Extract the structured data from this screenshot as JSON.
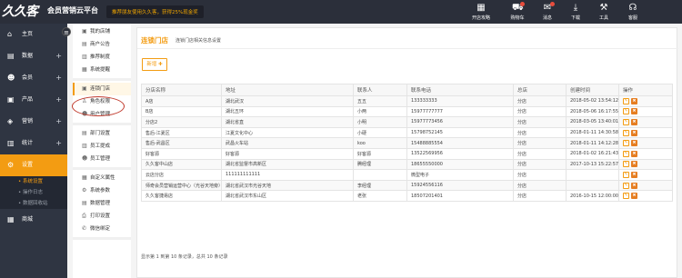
{
  "app": {
    "logo_text": "久久客",
    "title": "会员营销云平台",
    "promo": "推荐朋友使用久久客，获得25%现金奖"
  },
  "toolbar": [
    {
      "icon": "store-icon",
      "label": "开店攻略",
      "glyph": "▦",
      "badge": false
    },
    {
      "icon": "cart-icon",
      "label": "购物车",
      "glyph": "⛟",
      "badge": true
    },
    {
      "icon": "mail-icon",
      "label": "消息",
      "glyph": "✉",
      "badge": true
    },
    {
      "icon": "download-icon",
      "label": "下载",
      "glyph": "⤓",
      "badge": false
    },
    {
      "icon": "tools-icon",
      "label": "工具",
      "glyph": "⚒",
      "badge": false
    },
    {
      "icon": "service-icon",
      "label": "客服",
      "glyph": "☊",
      "badge": false
    }
  ],
  "sidebar": {
    "items": [
      {
        "label": "主页",
        "glyph": "⌂",
        "plus": false
      },
      {
        "label": "数据",
        "glyph": "▤",
        "plus": true
      },
      {
        "label": "会员",
        "glyph": "☻",
        "plus": true
      },
      {
        "label": "产品",
        "glyph": "▣",
        "plus": true
      },
      {
        "label": "营销",
        "glyph": "◈",
        "plus": true
      },
      {
        "label": "统计",
        "glyph": "▥",
        "plus": true
      },
      {
        "label": "设置",
        "glyph": "⚙",
        "plus": false
      },
      {
        "label": "商城",
        "glyph": "▦",
        "plus": false
      }
    ],
    "subitems": [
      "• 系统设置",
      "• 操作日志",
      "• 数据回收站"
    ]
  },
  "subnav": {
    "group1": [
      "我的店铺",
      "商户公告",
      "推荐制度",
      "系统提醒"
    ],
    "group2": [
      "连锁门店",
      "角色权限",
      "用户管理"
    ],
    "group3": [
      "部门设置",
      "员工提成",
      "员工管理"
    ],
    "group4": [
      "自定义属性",
      "系统参数",
      "数据管理",
      "打印设置",
      "微信绑定"
    ]
  },
  "page": {
    "title": "连锁门店",
    "subtitle": "连锁门店相关信息设置",
    "add_label": "新增 ✚",
    "columns": [
      "分店名称",
      "地址",
      "联系人",
      "联系电话",
      "总店",
      "创建时间",
      "操作"
    ],
    "rows": [
      [
        "A店",
        "湖北武汉",
        "五五",
        "133333333",
        "分店",
        "2018-05-02 13:54:12"
      ],
      [
        "B店",
        "湖北五环",
        "小两",
        "15977777777",
        "分店",
        "2018-05-06 16:17:55"
      ],
      [
        "分店2",
        "湖北省直",
        "小明",
        "15977773456",
        "分店",
        "2018-03-05 13:40:01"
      ],
      [
        "售后-江夏区",
        "江夏文化中心",
        "小硬",
        "15798752145",
        "分店",
        "2018-01-11 14:30:58"
      ],
      [
        "售后-武昌区",
        "武昌火车站",
        "koo",
        "15488885554",
        "分店",
        "2018-01-11 14:12:28"
      ],
      [
        "好客源",
        "好客源",
        "好客源",
        "13522569956",
        "分店",
        "2018-01-02 16:21:43"
      ],
      [
        "久久客中山店",
        "湖北省监督市高新区",
        "腾经理",
        "18655550000",
        "分店",
        "2017-10-13 15:22:57"
      ],
      [
        "云店分店",
        "111111111111",
        "",
        "微型电子",
        "分店",
        ""
      ],
      [
        "师奇会员营销运营中心（光谷天地旁）",
        "湖北省武汉市光谷天地",
        "李经理",
        "15924556116",
        "分店",
        ""
      ],
      [
        "久久客捷易店",
        "湖北省武汉市东山区",
        "老张",
        "18507201401",
        "分店",
        "2016-10-15 12:00:00"
      ]
    ],
    "footer": "显示第 1 到第 10 条记录，总共 10 条记录"
  }
}
